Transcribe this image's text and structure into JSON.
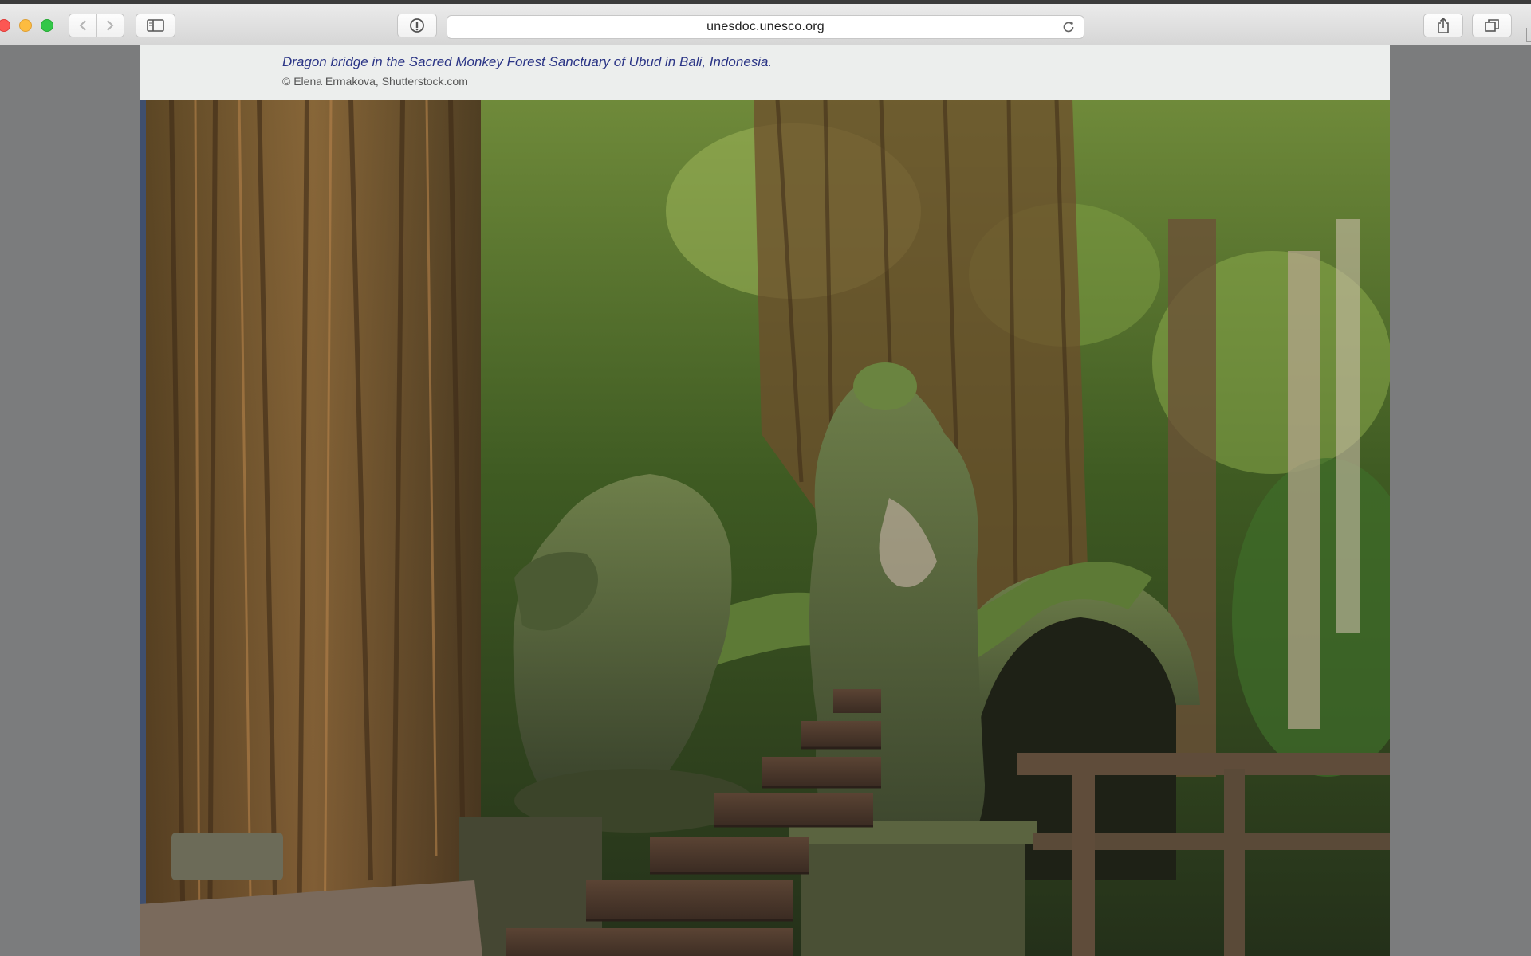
{
  "browser": {
    "url": "unesdoc.unesco.org"
  },
  "icons": {
    "close": "close-dot",
    "minimize": "minimize-dot",
    "zoom": "zoom-dot",
    "back": "chevron-left-icon",
    "forward": "chevron-right-icon",
    "sidebar": "sidebar-icon",
    "reader": "info-icon",
    "reload": "reload-icon",
    "share": "share-icon",
    "tabs": "tabs-icon"
  },
  "colors": {
    "caption_title": "#2b3586",
    "caption_band": "#eceeed",
    "desktop": "#7b7c7d"
  },
  "document": {
    "caption": {
      "title": "Dragon bridge in the Sacred Monkey Forest Sanctuary of Ubud in Bali, Indonesia.",
      "credit": "© Elena Ermakova, Shutterstock.com"
    },
    "photo_subject": "dragon-bridge-photo"
  }
}
